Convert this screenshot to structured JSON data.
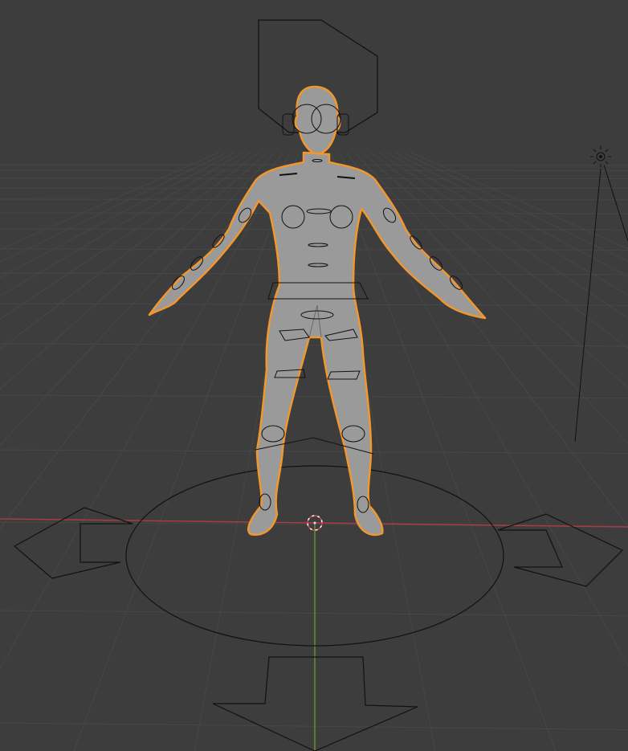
{
  "viewport": {
    "background_color": "#3d3d3d",
    "grid_color": "#4a4a4a",
    "x_axis_color": "#a83c48",
    "y_axis_color": "#6b8f2a",
    "selection_outline_color": "#f2962e",
    "mesh_color": "#9a9a9a",
    "rig_color": "#111111"
  },
  "icons": {
    "light": "light-icon",
    "cursor": "3d-cursor-icon"
  }
}
